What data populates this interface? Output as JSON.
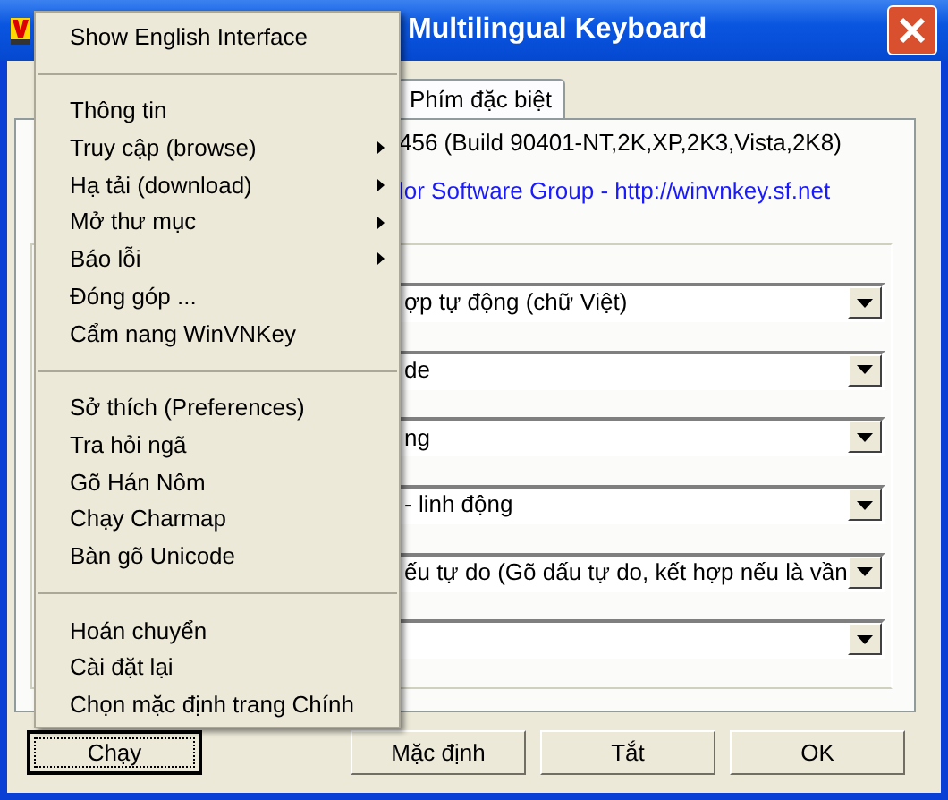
{
  "window": {
    "title": "Multilingual Keyboard"
  },
  "tabs": [
    {
      "label": "Phím đặc biệt",
      "selected": true
    }
  ],
  "info": {
    "version": "456 (Build 90401-NT,2K,XP,2K3,Vista,2K8)",
    "link": "lor Software Group - http://winvnkey.sf.net"
  },
  "dropdowns": [
    {
      "kind": "combo",
      "value": "ợp tự động (chữ Việt)"
    },
    {
      "kind": "combo",
      "value": "de"
    },
    {
      "kind": "combo",
      "value": "ng"
    },
    {
      "kind": "combo",
      "value": "- linh động"
    },
    {
      "kind": "combo",
      "value": "ếu tự do (Gõ dấu tự do, kết hợp nếu là vần"
    },
    {
      "kind": "combo"
    }
  ],
  "buttons": [
    {
      "label": "Chạy",
      "focused": true
    },
    {
      "label": "Mặc định",
      "focused": false
    },
    {
      "label": "Tắt",
      "focused": false
    },
    {
      "label": "OK",
      "focused": false
    }
  ],
  "context_menu": {
    "items": [
      {
        "kind": "item",
        "label": "Show English Interface",
        "submenu": false
      },
      {
        "kind": "separator"
      },
      {
        "kind": "item",
        "label": "Thông tin",
        "submenu": false
      },
      {
        "kind": "item",
        "label": "Truy cập (browse)",
        "submenu": true
      },
      {
        "kind": "item",
        "label": "Hạ tải (download)",
        "submenu": true
      },
      {
        "kind": "item",
        "label": "Mở thư mục",
        "submenu": true
      },
      {
        "kind": "item",
        "label": "Báo lỗi",
        "submenu": true
      },
      {
        "kind": "item",
        "label": "Đóng góp ...",
        "submenu": false
      },
      {
        "kind": "item",
        "label": "Cẩm nang WinVNKey",
        "submenu": false
      },
      {
        "kind": "separator"
      },
      {
        "kind": "item",
        "label": "Sở thích (Preferences)",
        "submenu": false
      },
      {
        "kind": "item",
        "label": "Tra hỏi ngã",
        "submenu": false
      },
      {
        "kind": "item",
        "label": "Gõ Hán Nôm",
        "submenu": false
      },
      {
        "kind": "item",
        "label": "Chạy Charmap",
        "submenu": false
      },
      {
        "kind": "item",
        "label": "Bàn gõ Unicode",
        "submenu": false
      },
      {
        "kind": "separator"
      },
      {
        "kind": "item",
        "label": "Hoán chuyển",
        "submenu": false
      },
      {
        "kind": "item",
        "label": "Cài đặt lại",
        "submenu": false
      },
      {
        "kind": "item",
        "label": "Chọn mặc định trang Chính",
        "submenu": false
      }
    ]
  }
}
